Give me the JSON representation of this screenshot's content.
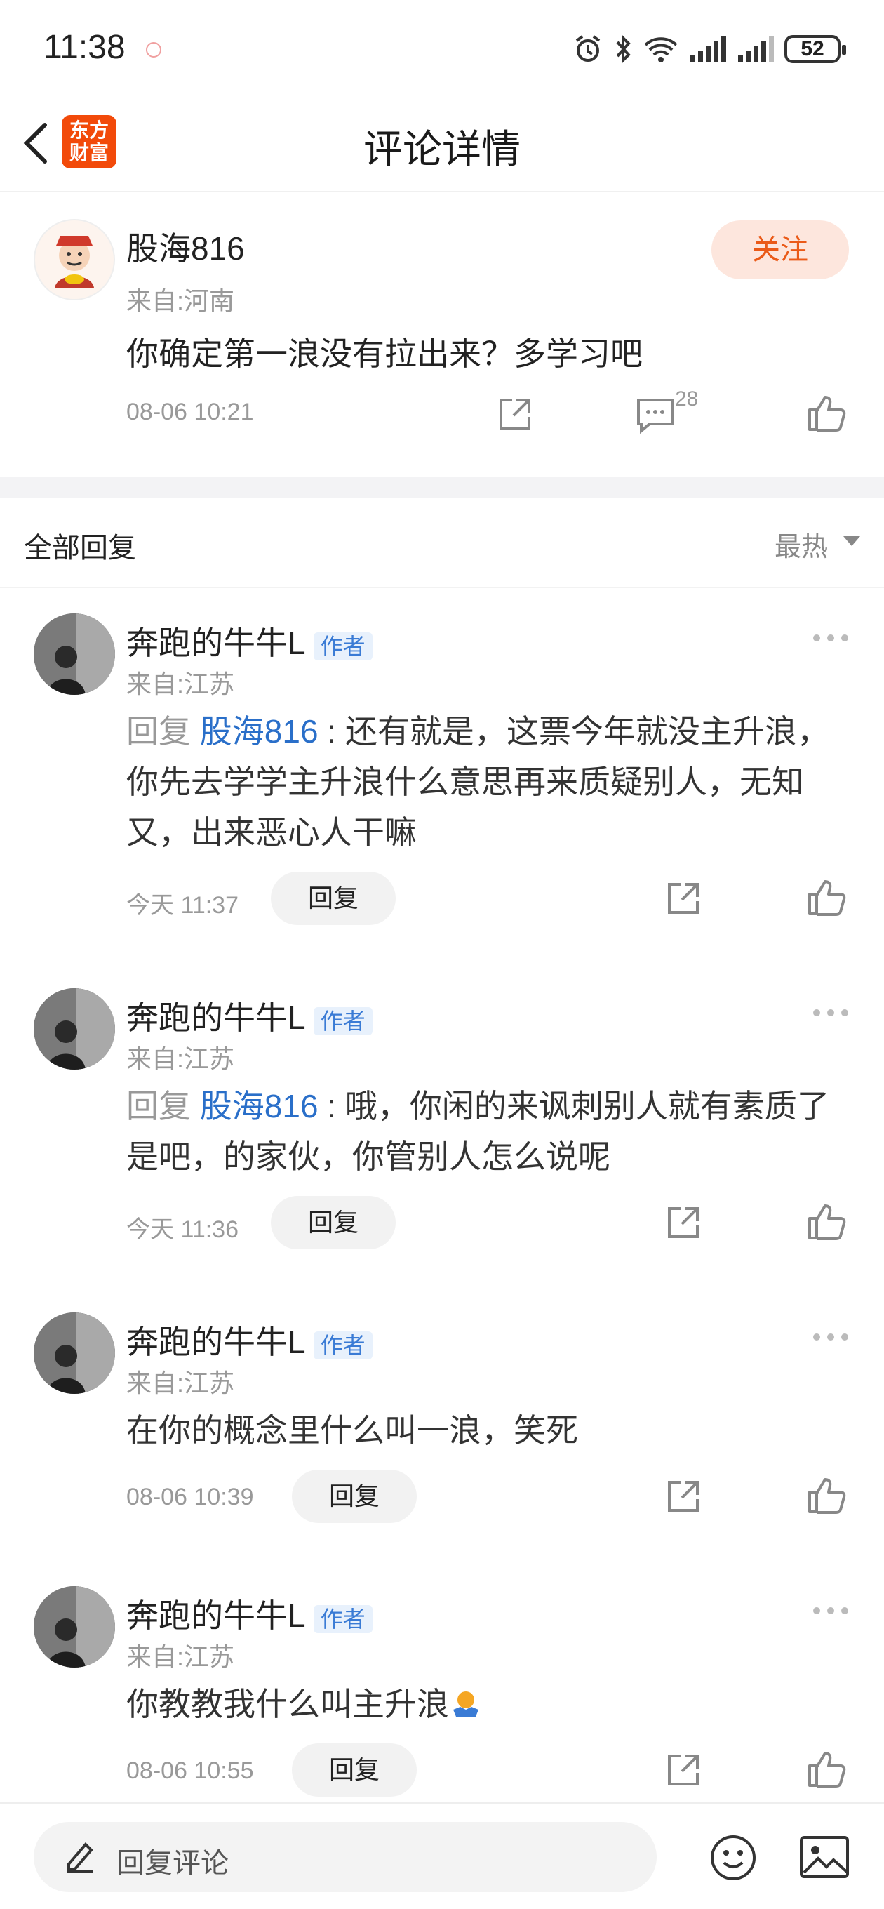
{
  "status_bar": {
    "time": "11:38",
    "battery": "52"
  },
  "header": {
    "title": "评论详情",
    "logo_line1": "东方",
    "logo_line2": "财富"
  },
  "main_comment": {
    "author": "股海816",
    "location": "来自:河南",
    "follow_label": "关注",
    "text": "你确定第一浪没有拉出来？多学习吧",
    "time": "08-06 10:21",
    "comment_count": "28"
  },
  "replies_header": {
    "label": "全部回复",
    "sort": "最热"
  },
  "replies": [
    {
      "author": "奔跑的牛牛L",
      "badge": "作者",
      "location": "来自:江苏",
      "prefix": "回复 ",
      "mention": "股海816",
      "text": " : 还有就是，这票今年就没主升浪，你先去学学主升浪什么意思再来质疑别人，无知又，出来恶心人干嘛",
      "time": "今天 11:37",
      "reply_label": "回复"
    },
    {
      "author": "奔跑的牛牛L",
      "badge": "作者",
      "location": "来自:江苏",
      "prefix": "回复 ",
      "mention": "股海816",
      "text": " : 哦，你闲的来讽刺别人就有素质了是吧，的家伙，你管别人怎么说呢",
      "time": "今天 11:36",
      "reply_label": "回复"
    },
    {
      "author": "奔跑的牛牛L",
      "badge": "作者",
      "location": "来自:江苏",
      "text": "在你的概念里什么叫一浪，笑死",
      "time": "08-06 10:39",
      "reply_label": "回复"
    },
    {
      "author": "奔跑的牛牛L",
      "badge": "作者",
      "location": "来自:江苏",
      "text": "你教教我什么叫主升浪",
      "time": "08-06 10:55",
      "reply_label": "回复"
    }
  ],
  "bottom_bar": {
    "placeholder": "回复评论"
  },
  "colors": {
    "accent": "#ea5a18",
    "mention": "#2a6fc9",
    "logo": "#f24a0a"
  }
}
